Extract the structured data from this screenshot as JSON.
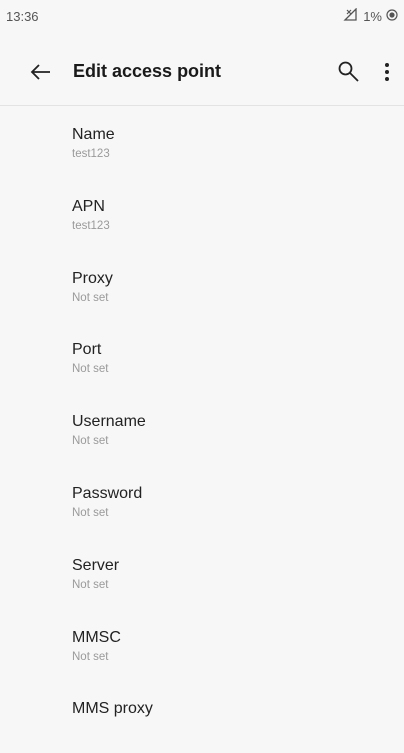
{
  "status_bar": {
    "time": "13:36",
    "battery": "1%"
  },
  "app_bar": {
    "title": "Edit access point",
    "icons": [
      "back-arrow-icon",
      "search-icon",
      "more-vert-icon"
    ]
  },
  "settings": [
    {
      "title": "Name",
      "value": "test123"
    },
    {
      "title": "APN",
      "value": "test123"
    },
    {
      "title": "Proxy",
      "value": "Not set"
    },
    {
      "title": "Port",
      "value": "Not set"
    },
    {
      "title": "Username",
      "value": "Not set"
    },
    {
      "title": "Password",
      "value": "Not set"
    },
    {
      "title": "Server",
      "value": "Not set"
    },
    {
      "title": "MMSC",
      "value": "Not set"
    },
    {
      "title": "MMS proxy",
      "value": ""
    }
  ]
}
